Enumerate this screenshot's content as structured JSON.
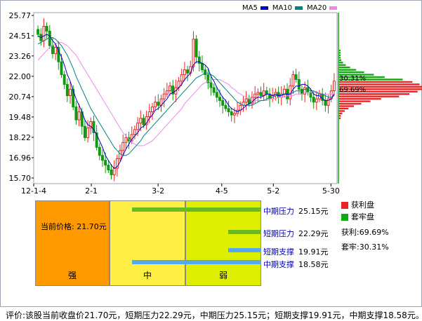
{
  "legend": {
    "ma5": {
      "label": "MA5",
      "color": "#0000cc"
    },
    "ma10": {
      "label": "MA10",
      "color": "#008080"
    },
    "ma20": {
      "label": "MA20",
      "color": "#ee88ee"
    }
  },
  "chart_data": {
    "type": "candlestick",
    "y_ticks": [
      "25.77",
      "24.51",
      "23.26",
      "22.00",
      "20.74",
      "19.48",
      "18.22",
      "16.96",
      "15.70"
    ],
    "ylim": [
      15.7,
      25.77
    ],
    "x_ticks": [
      "12-1-4",
      "2-1",
      "3-2",
      "4-5",
      "5-2",
      "5-30"
    ],
    "up_color": "#ee2222",
    "down_color": "#119911",
    "close_series": [
      24.6,
      24.2,
      25.1,
      24.8,
      23.9,
      23.4,
      23.8,
      22.9,
      22.1,
      21.5,
      20.8,
      21.2,
      20.1,
      19.3,
      19.8,
      18.9,
      18.2,
      18.8,
      19.2,
      18.5,
      17.6,
      17.1,
      16.8,
      16.5,
      16.2,
      15.9,
      16.3,
      16.9,
      17.4,
      17.9,
      18.2,
      18.0,
      18.4,
      18.7,
      19.1,
      19.4,
      19.0,
      19.5,
      19.8,
      20.1,
      20.4,
      20.2,
      20.6,
      20.9,
      21.1,
      21.4,
      20.9,
      21.3,
      21.7,
      22.1,
      22.4,
      22.2,
      22.6,
      24.3,
      23.2,
      22.8,
      22.4,
      22.1,
      21.6,
      21.3,
      21.0,
      20.7,
      20.5,
      20.2,
      20.0,
      19.8,
      19.6,
      19.7,
      19.9,
      20.2,
      20.4,
      20.6,
      20.3,
      20.7,
      20.9,
      21.0,
      20.8,
      21.1,
      20.9,
      20.6,
      20.8,
      21.0,
      20.7,
      20.9,
      21.2,
      20.6,
      21.4,
      22.1,
      21.8,
      21.2,
      20.9,
      21.3,
      21.0,
      20.7,
      20.4,
      20.6,
      20.9,
      20.5,
      20.2,
      20.6,
      21.1,
      21.7
    ],
    "ma5": [
      24.5,
      24.4,
      24.5,
      24.6,
      24.5,
      24.2,
      24.0,
      23.6,
      23.2,
      22.7,
      22.1,
      21.7,
      21.1,
      20.6,
      20.2,
      19.8,
      19.3,
      19.0,
      18.9,
      18.7,
      18.4,
      18.0,
      17.6,
      17.1,
      16.8,
      16.5,
      16.3,
      16.4,
      16.7,
      17.1,
      17.5,
      17.8,
      18.1,
      18.3,
      18.5,
      18.8,
      18.9,
      19.1,
      19.4,
      19.6,
      19.9,
      20.0,
      20.2,
      20.4,
      20.6,
      20.9,
      21.0,
      21.1,
      21.3,
      21.5,
      21.8,
      22.0,
      22.2,
      22.7,
      22.9,
      22.9,
      22.8,
      22.7,
      22.5,
      22.0,
      21.7,
      21.3,
      21.0,
      20.7,
      20.5,
      20.2,
      20.0,
      19.9,
      19.8,
      19.9,
      20.0,
      20.2,
      20.3,
      20.4,
      20.6,
      20.7,
      20.7,
      20.8,
      20.9,
      20.9,
      20.8,
      20.9,
      20.8,
      20.8,
      20.9,
      20.9,
      20.9,
      21.2,
      21.4,
      21.4,
      21.5,
      21.5,
      21.4,
      21.2,
      20.9,
      20.8,
      20.8,
      20.6,
      20.5,
      20.5,
      20.6,
      20.9
    ],
    "ma10": [
      24.0,
      24.1,
      24.2,
      24.3,
      24.4,
      24.4,
      24.3,
      24.1,
      23.9,
      23.6,
      23.3,
      22.9,
      22.5,
      22.0,
      21.6,
      21.2,
      20.8,
      20.4,
      20.0,
      19.7,
      19.4,
      19.1,
      18.8,
      18.5,
      18.2,
      17.9,
      17.6,
      17.4,
      17.2,
      17.1,
      17.1,
      17.2,
      17.4,
      17.6,
      17.8,
      18.0,
      18.3,
      18.5,
      18.7,
      18.9,
      19.1,
      19.3,
      19.5,
      19.7,
      19.9,
      20.1,
      20.3,
      20.5,
      20.7,
      20.9,
      21.1,
      21.3,
      21.5,
      21.7,
      21.9,
      22.0,
      22.1,
      22.2,
      22.2,
      22.1,
      22.0,
      21.8,
      21.6,
      21.4,
      21.2,
      21.0,
      20.8,
      20.6,
      20.4,
      20.3,
      20.2,
      20.2,
      20.2,
      20.2,
      20.3,
      20.4,
      20.5,
      20.5,
      20.6,
      20.7,
      20.7,
      20.8,
      20.8,
      20.9,
      20.9,
      20.9,
      20.9,
      21.0,
      21.1,
      21.1,
      21.1,
      21.2,
      21.2,
      21.1,
      21.1,
      21.0,
      20.9,
      20.9,
      20.8,
      20.7,
      20.7,
      20.8
    ],
    "ma20": [
      23.0,
      23.2,
      23.4,
      23.6,
      23.8,
      23.9,
      24.0,
      24.1,
      24.1,
      24.0,
      23.9,
      23.7,
      23.5,
      23.3,
      23.0,
      22.7,
      22.4,
      22.1,
      21.8,
      21.5,
      21.2,
      20.9,
      20.6,
      20.3,
      20.0,
      19.7,
      19.4,
      19.1,
      18.8,
      18.5,
      18.3,
      18.1,
      17.9,
      17.8,
      17.7,
      17.7,
      17.7,
      17.8,
      17.9,
      18.0,
      18.2,
      18.4,
      18.6,
      18.8,
      19.0,
      19.2,
      19.4,
      19.6,
      19.8,
      20.0,
      20.3,
      20.5,
      20.7,
      20.9,
      21.1,
      21.3,
      21.5,
      21.6,
      21.7,
      21.8,
      21.8,
      21.8,
      21.8,
      21.7,
      21.6,
      21.5,
      21.3,
      21.2,
      21.0,
      20.9,
      20.8,
      20.7,
      20.6,
      20.5,
      20.5,
      20.5,
      20.5,
      20.5,
      20.5,
      20.6,
      20.6,
      20.6,
      20.7,
      20.7,
      20.7,
      20.8,
      20.8,
      20.8,
      20.9,
      20.9,
      20.9,
      21.0,
      21.0,
      21.0,
      21.0,
      21.0,
      21.0,
      20.9,
      20.9,
      20.9,
      20.9,
      20.9
    ]
  },
  "distribution": {
    "profit_pct_label": "69.69%",
    "trapped_pct_label": "30.31%",
    "profit_color": "#ee2222",
    "trapped_color": "#11aa11"
  },
  "strength_zones": {
    "strong": {
      "label": "强",
      "color": "#ff9900"
    },
    "medium": {
      "label": "中",
      "color": "#ffee44"
    },
    "weak": {
      "label": "弱",
      "color": "#ddee00"
    }
  },
  "current_price": {
    "label": "当前价格:",
    "value": "21.70元"
  },
  "levels": [
    {
      "label": "中期压力",
      "value": "25.15元",
      "bar_start": 0.15,
      "bar_color": "#66bb22"
    },
    {
      "label": "短期压力",
      "value": "22.29元",
      "bar_start": 0.79,
      "bar_color": "#66bb22"
    },
    {
      "label": "短期支撑",
      "value": "19.91元",
      "bar_start": 0.79,
      "bar_color": "#55aaee"
    },
    {
      "label": "中期支撑",
      "value": "18.58元",
      "bar_start": 0.15,
      "bar_color": "#55aaee"
    }
  ],
  "side_legend": {
    "profit_label": "获利盘",
    "trapped_label": "套牢盘",
    "profit_ratio": "获利:69.69%",
    "trapped_ratio": "套牢:30.31%"
  },
  "summary_text": "评价:该股当前收盘价21.70元，短期压力22.29元，中期压力25.15元；短期支撑19.91元，中期支撑18.58元。"
}
